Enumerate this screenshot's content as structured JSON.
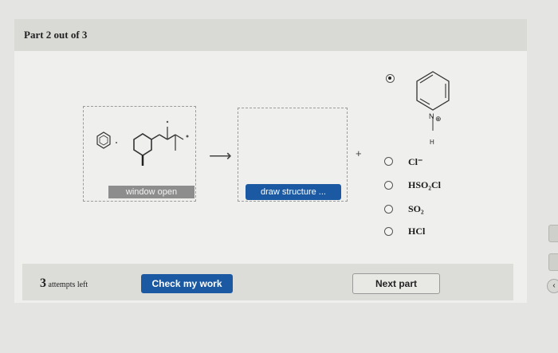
{
  "header": {
    "title": "Part 2 out of 3"
  },
  "reaction": {
    "window_button": "window open",
    "draw_button": "draw structure ...",
    "arrow": "⟶",
    "plus": "+"
  },
  "options": [
    {
      "label": "",
      "selected": true
    },
    {
      "label": "Cl⁻",
      "selected": false
    },
    {
      "label": "HSO₂Cl",
      "selected": false
    },
    {
      "label": "SO₂",
      "selected": false
    },
    {
      "label": "HCl",
      "selected": false
    }
  ],
  "pyridinium": {
    "n_label": "N",
    "charge": "⊕",
    "h_label": "H"
  },
  "footer": {
    "attempts_count": "3",
    "attempts_text": "attempts left",
    "check_button": "Check my work",
    "next_button": "Next part"
  },
  "icons": {
    "selected_radio": "radio-selected",
    "side_nav": "chevron-icon"
  }
}
